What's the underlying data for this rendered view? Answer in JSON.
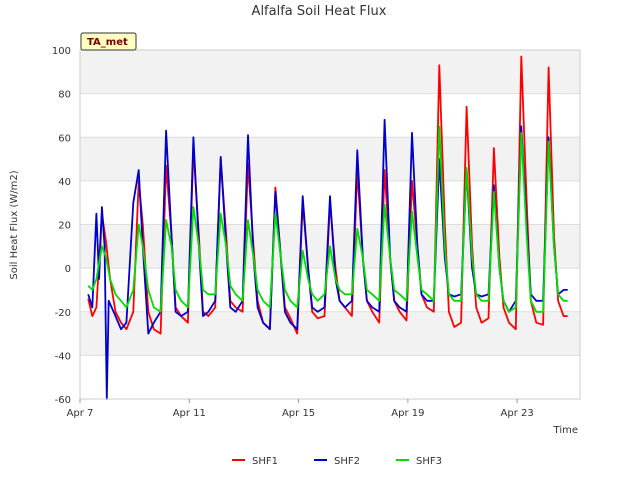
{
  "chart_data": {
    "type": "line",
    "title": "Alfalfa Soil Heat Flux",
    "xlabel": "Time",
    "ylabel": "Soil Heat Flux (W/m2)",
    "badge": "TA_met",
    "ylim": [
      -60,
      100
    ],
    "yticks": [
      -60,
      -40,
      -20,
      0,
      20,
      40,
      60,
      80,
      100
    ],
    "xlim_day": [
      7,
      25.3
    ],
    "xticks": [
      {
        "day": 7,
        "label": "Apr 7"
      },
      {
        "day": 11,
        "label": "Apr 11"
      },
      {
        "day": 15,
        "label": "Apr 15"
      },
      {
        "day": 19,
        "label": "Apr 19"
      },
      {
        "day": 23,
        "label": "Apr 23"
      }
    ],
    "grid": true,
    "legend_position": "bottom",
    "series": [
      {
        "name": "SHF1",
        "color": "#ff0000",
        "points": [
          [
            7.3,
            -14
          ],
          [
            7.45,
            -22
          ],
          [
            7.6,
            -18
          ],
          [
            7.8,
            25
          ],
          [
            7.95,
            12
          ],
          [
            8.1,
            -5
          ],
          [
            8.3,
            -20
          ],
          [
            8.5,
            -25
          ],
          [
            8.7,
            -28
          ],
          [
            8.95,
            -20
          ],
          [
            9.15,
            40
          ],
          [
            9.3,
            20
          ],
          [
            9.5,
            -20
          ],
          [
            9.7,
            -28
          ],
          [
            9.95,
            -30
          ],
          [
            10.15,
            47
          ],
          [
            10.35,
            15
          ],
          [
            10.5,
            -18
          ],
          [
            10.7,
            -22
          ],
          [
            10.95,
            -25
          ],
          [
            11.15,
            55
          ],
          [
            11.35,
            15
          ],
          [
            11.5,
            -20
          ],
          [
            11.7,
            -22
          ],
          [
            11.95,
            -18
          ],
          [
            12.15,
            50
          ],
          [
            12.35,
            15
          ],
          [
            12.5,
            -15
          ],
          [
            12.7,
            -18
          ],
          [
            12.95,
            -20
          ],
          [
            13.15,
            48
          ],
          [
            13.35,
            10
          ],
          [
            13.5,
            -15
          ],
          [
            13.7,
            -25
          ],
          [
            13.95,
            -28
          ],
          [
            14.15,
            37
          ],
          [
            14.35,
            5
          ],
          [
            14.5,
            -18
          ],
          [
            14.7,
            -23
          ],
          [
            14.95,
            -30
          ],
          [
            15.15,
            30
          ],
          [
            15.35,
            0
          ],
          [
            15.5,
            -20
          ],
          [
            15.7,
            -23
          ],
          [
            15.95,
            -22
          ],
          [
            16.15,
            30
          ],
          [
            16.35,
            0
          ],
          [
            16.5,
            -15
          ],
          [
            16.7,
            -18
          ],
          [
            16.95,
            -22
          ],
          [
            17.15,
            45
          ],
          [
            17.35,
            5
          ],
          [
            17.5,
            -15
          ],
          [
            17.7,
            -20
          ],
          [
            17.95,
            -25
          ],
          [
            18.15,
            45
          ],
          [
            18.35,
            5
          ],
          [
            18.5,
            -15
          ],
          [
            18.7,
            -20
          ],
          [
            18.95,
            -24
          ],
          [
            19.15,
            40
          ],
          [
            19.35,
            10
          ],
          [
            19.5,
            -12
          ],
          [
            19.7,
            -18
          ],
          [
            19.95,
            -20
          ],
          [
            20.15,
            93
          ],
          [
            20.35,
            20
          ],
          [
            20.5,
            -20
          ],
          [
            20.7,
            -27
          ],
          [
            20.95,
            -25
          ],
          [
            21.15,
            74
          ],
          [
            21.35,
            10
          ],
          [
            21.5,
            -18
          ],
          [
            21.7,
            -25
          ],
          [
            21.95,
            -23
          ],
          [
            22.15,
            55
          ],
          [
            22.35,
            5
          ],
          [
            22.5,
            -18
          ],
          [
            22.7,
            -25
          ],
          [
            22.95,
            -28
          ],
          [
            23.15,
            97
          ],
          [
            23.35,
            30
          ],
          [
            23.5,
            -15
          ],
          [
            23.7,
            -25
          ],
          [
            23.95,
            -26
          ],
          [
            24.15,
            92
          ],
          [
            24.35,
            15
          ],
          [
            24.5,
            -15
          ],
          [
            24.7,
            -22
          ],
          [
            24.85,
            -22
          ]
        ]
      },
      {
        "name": "SHF2",
        "color": "#0000cc",
        "points": [
          [
            7.3,
            -12
          ],
          [
            7.45,
            -18
          ],
          [
            7.6,
            25
          ],
          [
            7.7,
            -5
          ],
          [
            7.8,
            28
          ],
          [
            7.9,
            10
          ],
          [
            7.98,
            -60
          ],
          [
            8.05,
            -15
          ],
          [
            8.3,
            -22
          ],
          [
            8.5,
            -28
          ],
          [
            8.7,
            -25
          ],
          [
            8.95,
            30
          ],
          [
            9.15,
            45
          ],
          [
            9.3,
            10
          ],
          [
            9.5,
            -30
          ],
          [
            9.7,
            -25
          ],
          [
            9.95,
            -20
          ],
          [
            10.15,
            63
          ],
          [
            10.35,
            15
          ],
          [
            10.5,
            -20
          ],
          [
            10.7,
            -22
          ],
          [
            10.95,
            -20
          ],
          [
            11.15,
            60
          ],
          [
            11.35,
            10
          ],
          [
            11.5,
            -22
          ],
          [
            11.7,
            -20
          ],
          [
            11.95,
            -15
          ],
          [
            12.15,
            51
          ],
          [
            12.35,
            10
          ],
          [
            12.5,
            -18
          ],
          [
            12.7,
            -20
          ],
          [
            12.95,
            -15
          ],
          [
            13.15,
            61
          ],
          [
            13.35,
            5
          ],
          [
            13.5,
            -18
          ],
          [
            13.7,
            -25
          ],
          [
            13.95,
            -28
          ],
          [
            14.15,
            35
          ],
          [
            14.35,
            5
          ],
          [
            14.5,
            -20
          ],
          [
            14.7,
            -25
          ],
          [
            14.95,
            -28
          ],
          [
            15.15,
            33
          ],
          [
            15.35,
            0
          ],
          [
            15.5,
            -18
          ],
          [
            15.7,
            -20
          ],
          [
            15.95,
            -18
          ],
          [
            16.15,
            33
          ],
          [
            16.35,
            -5
          ],
          [
            16.5,
            -15
          ],
          [
            16.7,
            -18
          ],
          [
            16.95,
            -15
          ],
          [
            17.15,
            54
          ],
          [
            17.35,
            5
          ],
          [
            17.5,
            -15
          ],
          [
            17.7,
            -18
          ],
          [
            17.95,
            -20
          ],
          [
            18.15,
            68
          ],
          [
            18.35,
            5
          ],
          [
            18.5,
            -15
          ],
          [
            18.7,
            -18
          ],
          [
            18.95,
            -20
          ],
          [
            19.15,
            62
          ],
          [
            19.35,
            10
          ],
          [
            19.5,
            -12
          ],
          [
            19.7,
            -15
          ],
          [
            19.95,
            -15
          ],
          [
            20.15,
            50
          ],
          [
            20.35,
            5
          ],
          [
            20.5,
            -12
          ],
          [
            20.7,
            -13
          ],
          [
            20.95,
            -12
          ],
          [
            21.15,
            45
          ],
          [
            21.35,
            0
          ],
          [
            21.5,
            -12
          ],
          [
            21.7,
            -13
          ],
          [
            21.95,
            -12
          ],
          [
            22.15,
            38
          ],
          [
            22.35,
            0
          ],
          [
            22.5,
            -15
          ],
          [
            22.7,
            -20
          ],
          [
            22.95,
            -15
          ],
          [
            23.15,
            65
          ],
          [
            23.35,
            20
          ],
          [
            23.5,
            -12
          ],
          [
            23.7,
            -15
          ],
          [
            23.95,
            -15
          ],
          [
            24.15,
            60
          ],
          [
            24.35,
            10
          ],
          [
            24.5,
            -12
          ],
          [
            24.7,
            -10
          ],
          [
            24.85,
            -10
          ]
        ]
      },
      {
        "name": "SHF3",
        "color": "#00dd00",
        "points": [
          [
            7.3,
            -8
          ],
          [
            7.45,
            -10
          ],
          [
            7.6,
            -5
          ],
          [
            7.8,
            10
          ],
          [
            7.95,
            5
          ],
          [
            8.1,
            -5
          ],
          [
            8.3,
            -12
          ],
          [
            8.5,
            -15
          ],
          [
            8.7,
            -18
          ],
          [
            8.95,
            -10
          ],
          [
            9.15,
            20
          ],
          [
            9.3,
            10
          ],
          [
            9.5,
            -10
          ],
          [
            9.7,
            -18
          ],
          [
            9.95,
            -20
          ],
          [
            10.15,
            22
          ],
          [
            10.35,
            10
          ],
          [
            10.5,
            -10
          ],
          [
            10.7,
            -15
          ],
          [
            10.95,
            -18
          ],
          [
            11.15,
            28
          ],
          [
            11.35,
            10
          ],
          [
            11.5,
            -10
          ],
          [
            11.7,
            -12
          ],
          [
            11.95,
            -12
          ],
          [
            12.15,
            25
          ],
          [
            12.35,
            10
          ],
          [
            12.5,
            -8
          ],
          [
            12.7,
            -12
          ],
          [
            12.95,
            -15
          ],
          [
            13.15,
            22
          ],
          [
            13.35,
            5
          ],
          [
            13.5,
            -10
          ],
          [
            13.7,
            -15
          ],
          [
            13.95,
            -18
          ],
          [
            14.15,
            25
          ],
          [
            14.35,
            5
          ],
          [
            14.5,
            -10
          ],
          [
            14.7,
            -15
          ],
          [
            14.95,
            -18
          ],
          [
            15.15,
            8
          ],
          [
            15.35,
            -5
          ],
          [
            15.5,
            -12
          ],
          [
            15.7,
            -15
          ],
          [
            15.95,
            -12
          ],
          [
            16.15,
            10
          ],
          [
            16.35,
            -5
          ],
          [
            16.5,
            -10
          ],
          [
            16.7,
            -12
          ],
          [
            16.95,
            -12
          ],
          [
            17.15,
            18
          ],
          [
            17.35,
            5
          ],
          [
            17.5,
            -10
          ],
          [
            17.7,
            -12
          ],
          [
            17.95,
            -15
          ],
          [
            18.15,
            29
          ],
          [
            18.35,
            5
          ],
          [
            18.5,
            -10
          ],
          [
            18.7,
            -12
          ],
          [
            18.95,
            -15
          ],
          [
            19.15,
            26
          ],
          [
            19.35,
            5
          ],
          [
            19.5,
            -10
          ],
          [
            19.7,
            -12
          ],
          [
            19.95,
            -15
          ],
          [
            20.15,
            65
          ],
          [
            20.35,
            10
          ],
          [
            20.5,
            -12
          ],
          [
            20.7,
            -15
          ],
          [
            20.95,
            -15
          ],
          [
            21.15,
            46
          ],
          [
            21.35,
            5
          ],
          [
            21.5,
            -12
          ],
          [
            21.7,
            -15
          ],
          [
            21.95,
            -15
          ],
          [
            22.15,
            35
          ],
          [
            22.35,
            0
          ],
          [
            22.5,
            -15
          ],
          [
            22.7,
            -20
          ],
          [
            22.95,
            -18
          ],
          [
            23.15,
            62
          ],
          [
            23.35,
            15
          ],
          [
            23.5,
            -15
          ],
          [
            23.7,
            -20
          ],
          [
            23.95,
            -20
          ],
          [
            24.15,
            58
          ],
          [
            24.35,
            10
          ],
          [
            24.5,
            -12
          ],
          [
            24.7,
            -15
          ],
          [
            24.85,
            -15
          ]
        ]
      }
    ]
  }
}
